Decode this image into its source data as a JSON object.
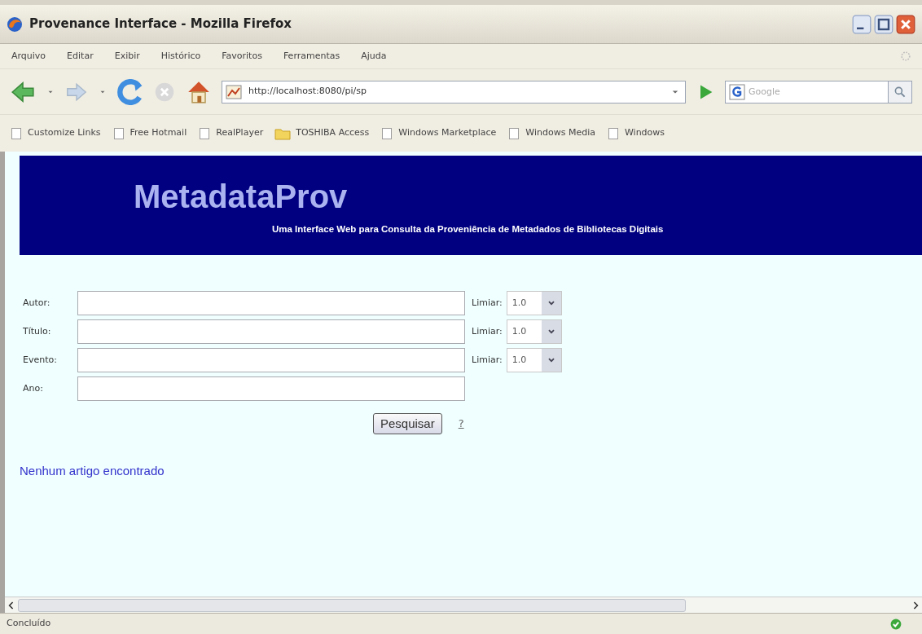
{
  "window": {
    "title": "Provenance Interface - Mozilla Firefox"
  },
  "menu": [
    "Arquivo",
    "Editar",
    "Exibir",
    "Histórico",
    "Favoritos",
    "Ferramentas",
    "Ajuda"
  ],
  "address_bar": {
    "url": "http://localhost:8080/pi/sp"
  },
  "search": {
    "placeholder": "Google"
  },
  "bookmarks": [
    {
      "label": "Customize Links",
      "kind": "page"
    },
    {
      "label": "Free Hotmail",
      "kind": "page"
    },
    {
      "label": "RealPlayer",
      "kind": "page"
    },
    {
      "label": "TOSHIBA Access",
      "kind": "folder"
    },
    {
      "label": "Windows Marketplace",
      "kind": "page"
    },
    {
      "label": "Windows Media",
      "kind": "page"
    },
    {
      "label": "Windows",
      "kind": "page"
    }
  ],
  "banner": {
    "title": "MetadataProv",
    "subtitle": "Uma Interface Web para Consulta da Proveniência de Metadados de Bibliotecas Digitais"
  },
  "form": {
    "fields": [
      {
        "label": "Autor:",
        "threshold_label": "Limiar:",
        "threshold": "1.0"
      },
      {
        "label": "Título:",
        "threshold_label": "Limiar:",
        "threshold": "1.0"
      },
      {
        "label": "Evento:",
        "threshold_label": "Limiar:",
        "threshold": "1.0"
      },
      {
        "label": "Ano:"
      }
    ],
    "button": "Pesquisar",
    "help_link": "?"
  },
  "message": "Nenhum artigo encontrado",
  "status_bar": {
    "text": "Concluído"
  }
}
